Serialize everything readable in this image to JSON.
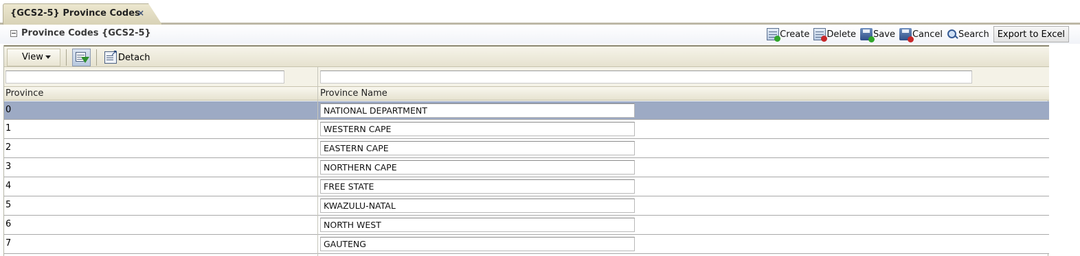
{
  "tab": {
    "title": "{GCS2-5} Province Codes",
    "close": "×"
  },
  "panel": {
    "title": "Province Codes {GCS2-5}"
  },
  "actions": {
    "create": "Create",
    "delete": "Delete",
    "save": "Save",
    "cancel": "Cancel",
    "search": "Search",
    "export": "Export to Excel"
  },
  "toolbar": {
    "view": "View",
    "detach": "Detach"
  },
  "filters": {
    "province": "",
    "province_name": ""
  },
  "columns": {
    "province": "Province",
    "province_name": "Province Name"
  },
  "rows": [
    {
      "code": "0",
      "name": "NATIONAL DEPARTMENT",
      "selected": true
    },
    {
      "code": "1",
      "name": "WESTERN CAPE"
    },
    {
      "code": "2",
      "name": "EASTERN CAPE"
    },
    {
      "code": "3",
      "name": "NORTHERN CAPE"
    },
    {
      "code": "4",
      "name": "FREE STATE"
    },
    {
      "code": "5",
      "name": "KWAZULU-NATAL"
    },
    {
      "code": "6",
      "name": "NORTH WEST"
    },
    {
      "code": "7",
      "name": "GAUTENG"
    }
  ],
  "colors": {
    "selected_row": "#9daac4",
    "tab_bg": "#ddd7bb",
    "toolbar_bg": "#ece8d8"
  }
}
